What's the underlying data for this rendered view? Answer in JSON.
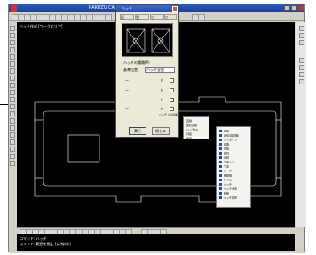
{
  "window": {
    "title": "RAKUZU CAD"
  },
  "canvas": {
    "label": "ハッチ作成 [ワークエリア]"
  },
  "dialog": {
    "title": "ハッチ",
    "tabs": [
      "形",
      "型",
      "▽",
      "▽"
    ],
    "section_label": "ハッチの種類(P)",
    "type_label": "基準位置",
    "type_value": "ハッチ全般",
    "rows": [
      {
        "label": "ー",
        "num": "0"
      },
      {
        "label": "ー",
        "num": "0"
      },
      {
        "label": "ー",
        "num": "0"
      },
      {
        "label": "ー",
        "num": "0"
      }
    ],
    "extra": "ハッチ入力基準",
    "ok_label": "実行",
    "cancel_label": "閉じる"
  },
  "context_menu": {
    "items": [
      "直線",
      "連続直線",
      "ハッチ(A)",
      "円弧",
      "矩形"
    ]
  },
  "submenu": {
    "items": [
      "直線",
      "連続(直交無)",
      "ポリライン",
      "四角",
      "円弧",
      "楕円",
      "曲線",
      "文字入力",
      "寸法",
      "カーブ",
      "補助線",
      "レンズ",
      "ハッチ",
      "ハッチ消去",
      "移動",
      "ハッチ設定"
    ]
  },
  "command": {
    "line1": "コマンド: ハッチ",
    "line2": "コマンド: 範囲を指定 [点/線/枠]"
  },
  "colors": {
    "titlebar": "#1a3f9a",
    "canvas_bg": "#000000",
    "dialog_bg": "#ece9d8"
  }
}
